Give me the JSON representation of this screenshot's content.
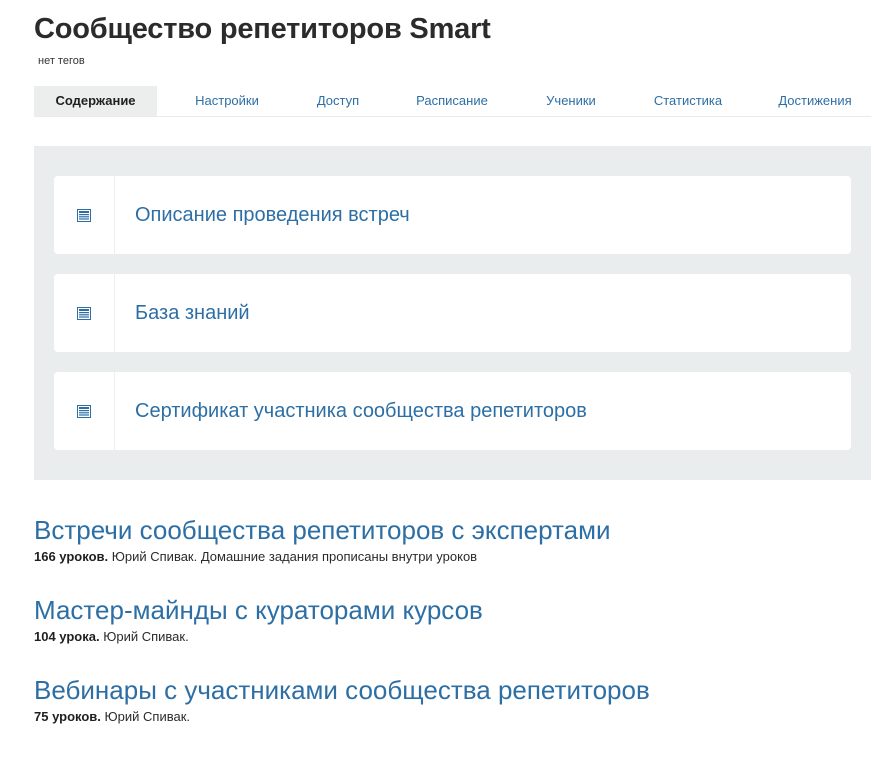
{
  "header": {
    "title": "Сообщество репетиторов Smart",
    "tags_note": "нет тегов"
  },
  "tabs": [
    {
      "label": "Содержание",
      "active": true
    },
    {
      "label": "Настройки",
      "active": false
    },
    {
      "label": "Доступ",
      "active": false
    },
    {
      "label": "Расписание",
      "active": false
    },
    {
      "label": "Ученики",
      "active": false
    },
    {
      "label": "Статистика",
      "active": false
    },
    {
      "label": "Достижения",
      "active": false
    }
  ],
  "modules": [
    {
      "icon": "document-list-icon",
      "title": "Описание проведения встреч"
    },
    {
      "icon": "document-list-icon",
      "title": "База знаний"
    },
    {
      "icon": "document-list-icon",
      "title": "Сертификат участника сообщества репетиторов"
    }
  ],
  "courses": [
    {
      "title": "Встречи сообщества репетиторов с экспертами",
      "lessons": "166 уроков.",
      "info": "Юрий Спивак. Домашние задания прописаны внутри уроков"
    },
    {
      "title": "Мастер-майнды с кураторами курсов",
      "lessons": "104 урока.",
      "info": "Юрий Спивак."
    },
    {
      "title": "Вебинары с участниками сообщества репетиторов",
      "lessons": "75 уроков.",
      "info": "Юрий Спивак."
    }
  ],
  "colors": {
    "link": "#2d6fa5",
    "panel_bg": "#eaeded",
    "active_tab_bg": "#eceeee"
  }
}
